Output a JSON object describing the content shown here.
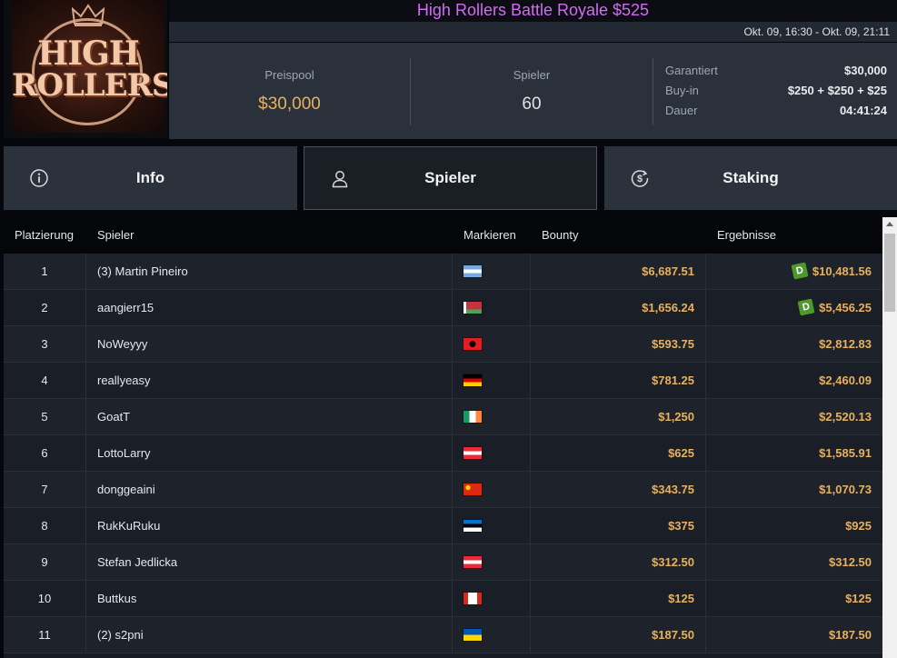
{
  "header": {
    "title": "High Rollers Battle Royale $525",
    "date_range": "Okt. 09, 16:30 - Okt. 09, 21:11",
    "logo_line1": "HIGH",
    "logo_line2": "ROLLERS"
  },
  "stats": {
    "pool_label": "Preispool",
    "pool_value": "$30,000",
    "players_label": "Spieler",
    "players_value": "60",
    "details": [
      {
        "label": "Garantiert",
        "value": "$30,000"
      },
      {
        "label": "Buy-in",
        "value": "$250 + $250 + $25"
      },
      {
        "label": "Dauer",
        "value": "04:41:24"
      }
    ]
  },
  "tabs": {
    "info": "Info",
    "players": "Spieler",
    "staking": "Staking",
    "active": "players"
  },
  "table": {
    "headers": {
      "place": "Platzierung",
      "player": "Spieler",
      "mark": "Markieren",
      "bounty": "Bounty",
      "results": "Ergebnisse"
    },
    "rows": [
      {
        "place": "1",
        "player": "(3) Martin Pineiro",
        "flag": "argentina",
        "bounty": "$6,687.51",
        "result": "$10,481.56",
        "badge": "D"
      },
      {
        "place": "2",
        "player": "aangierr15",
        "flag": "belarus",
        "bounty": "$1,656.24",
        "result": "$5,456.25",
        "badge": "D"
      },
      {
        "place": "3",
        "player": "NoWeyyy",
        "flag": "albania",
        "bounty": "$593.75",
        "result": "$2,812.83"
      },
      {
        "place": "4",
        "player": "reallyeasy",
        "flag": "germany",
        "bounty": "$781.25",
        "result": "$2,460.09"
      },
      {
        "place": "5",
        "player": "GoatT",
        "flag": "ireland",
        "bounty": "$1,250",
        "result": "$2,520.13"
      },
      {
        "place": "6",
        "player": "LottoLarry",
        "flag": "austria",
        "bounty": "$625",
        "result": "$1,585.91"
      },
      {
        "place": "7",
        "player": "donggeaini",
        "flag": "china",
        "bounty": "$343.75",
        "result": "$1,070.73"
      },
      {
        "place": "8",
        "player": "RukKuRuku",
        "flag": "estonia",
        "bounty": "$375",
        "result": "$925"
      },
      {
        "place": "9",
        "player": "Stefan Jedlicka",
        "flag": "austria",
        "bounty": "$312.50",
        "result": "$312.50"
      },
      {
        "place": "10",
        "player": "Buttkus",
        "flag": "canada",
        "bounty": "$125",
        "result": "$125"
      },
      {
        "place": "11",
        "player": "(2) s2pni",
        "flag": "ukraine",
        "bounty": "$187.50",
        "result": "$187.50"
      }
    ]
  },
  "colors": {
    "title": "#d26cf5",
    "gold": "#e6b160",
    "badge": "#4c9a2a"
  }
}
